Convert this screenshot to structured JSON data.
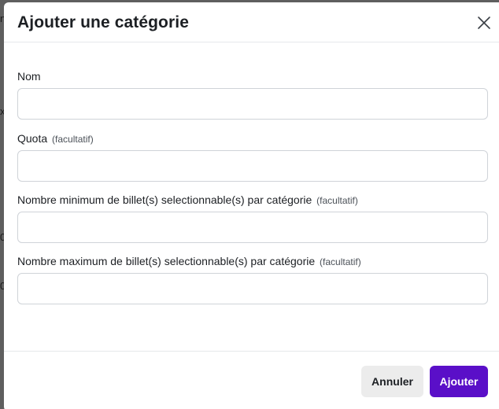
{
  "backdrop": {
    "fragments": [
      "n",
      "x",
      "0",
      "0"
    ]
  },
  "modal": {
    "title": "Ajouter une catégorie",
    "close_icon": "close-icon",
    "fields": [
      {
        "label": "Nom",
        "optional_text": "",
        "value": "",
        "placeholder": ""
      },
      {
        "label": "Quota",
        "optional_text": "(facultatif)",
        "value": "",
        "placeholder": ""
      },
      {
        "label": "Nombre minimum de billet(s) selectionnable(s) par catégorie",
        "optional_text": "(facultatif)",
        "value": "",
        "placeholder": ""
      },
      {
        "label": "Nombre maximum de billet(s) selectionnable(s) par catégorie",
        "optional_text": "(facultatif)",
        "value": "",
        "placeholder": ""
      }
    ],
    "footer": {
      "cancel_label": "Annuler",
      "submit_label": "Ajouter"
    }
  },
  "colors": {
    "primary": "#5a0fc8",
    "cancel_bg": "#ececec",
    "overlay": "#5f5f5f"
  }
}
